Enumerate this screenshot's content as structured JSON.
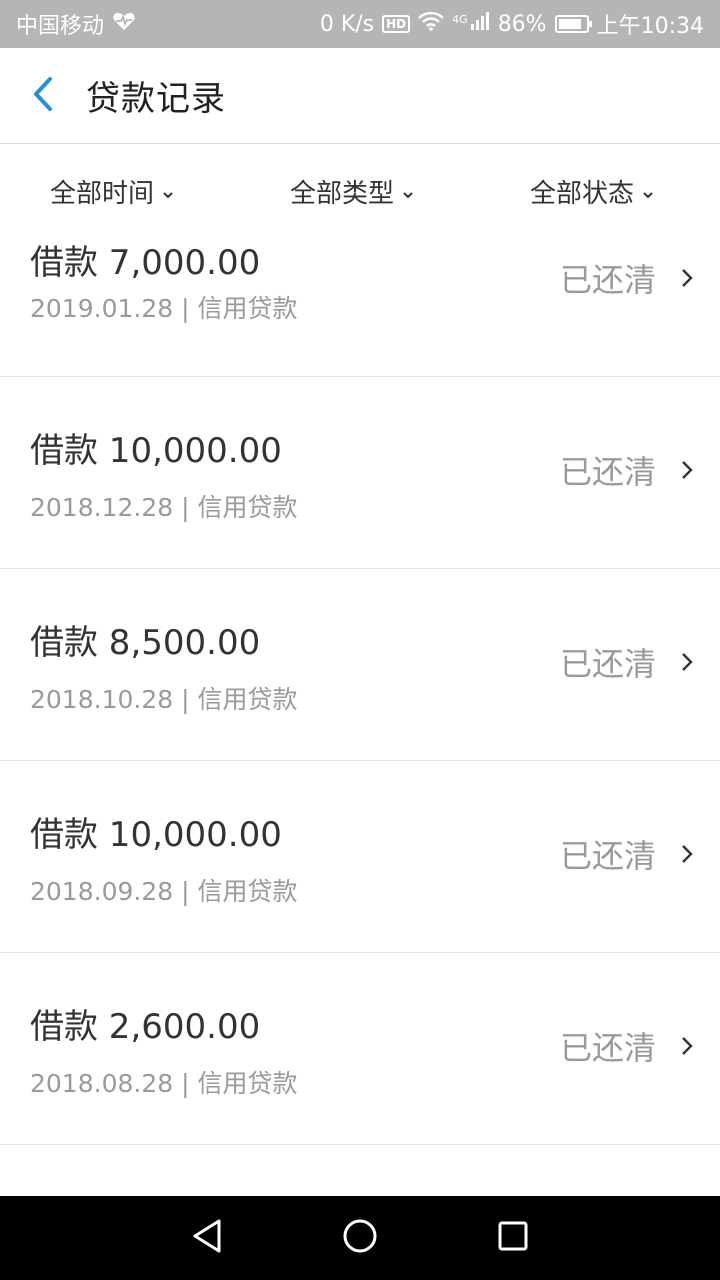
{
  "status_bar": {
    "carrier": "中国移动",
    "speed": "0 K/s",
    "hd": "HD",
    "network": "4G",
    "battery_level": "86%",
    "battery_fraction": 0.86,
    "time": "上午10:34"
  },
  "header": {
    "title": "贷款记录"
  },
  "filters": {
    "time": "全部时间",
    "type": "全部类型",
    "status": "全部状态"
  },
  "records": [
    {
      "title": "借款 7,000.00",
      "date": "2019.01.28",
      "category": "信用贷款",
      "status": "已还清"
    },
    {
      "title": "借款 10,000.00",
      "date": "2018.12.28",
      "category": "信用贷款",
      "status": "已还清"
    },
    {
      "title": "借款 8,500.00",
      "date": "2018.10.28",
      "category": "信用贷款",
      "status": "已还清"
    },
    {
      "title": "借款 10,000.00",
      "date": "2018.09.28",
      "category": "信用贷款",
      "status": "已还清"
    },
    {
      "title": "借款 2,600.00",
      "date": "2018.08.28",
      "category": "信用贷款",
      "status": "已还清"
    }
  ],
  "separator": "|",
  "colors": {
    "accent": "#2a8fd8",
    "status_bar_bg": "#b5b5b5",
    "muted_text": "#9a9a9a"
  }
}
